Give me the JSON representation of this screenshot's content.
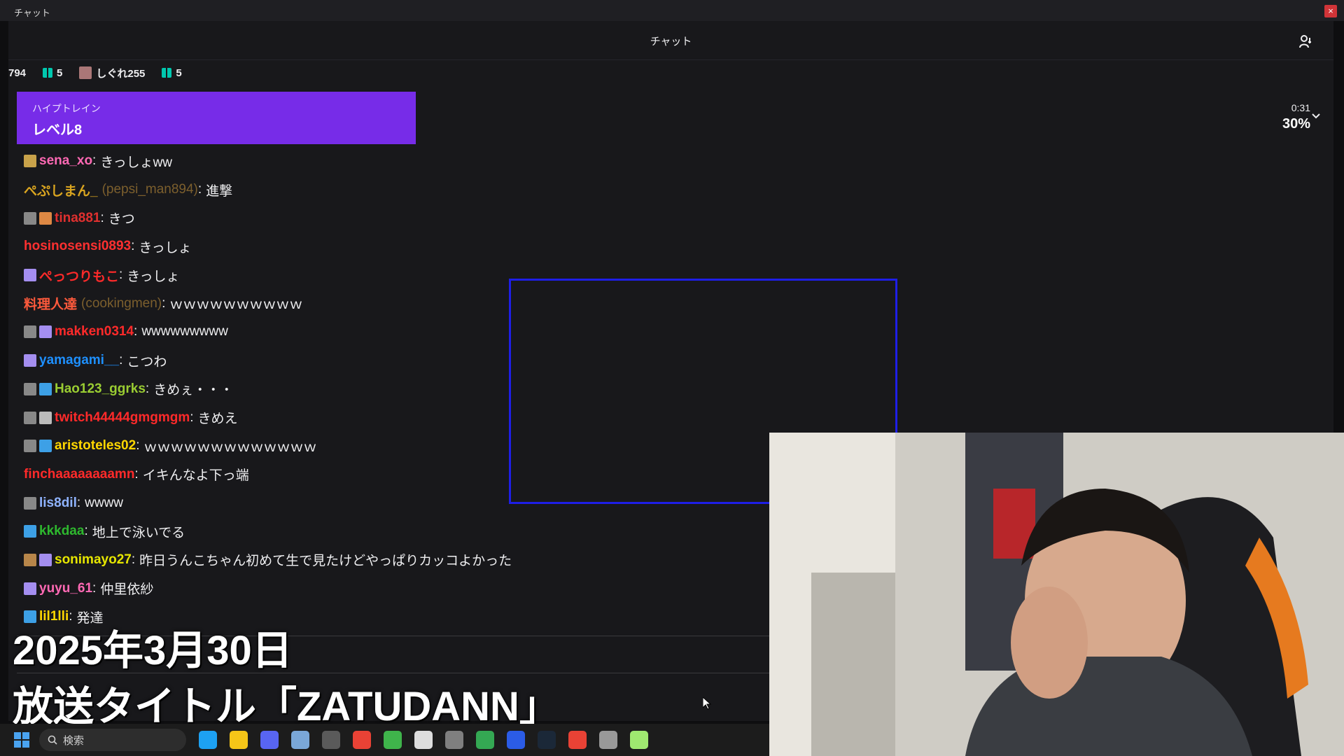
{
  "window": {
    "title": "チャット",
    "close_glyph": "×"
  },
  "chat": {
    "header_title": "チャット",
    "gifts": [
      {
        "label": "794",
        "icon": "none"
      },
      {
        "label": "5",
        "icon": "gift-icon"
      },
      {
        "label": "しぐれ255",
        "icon": "avatar-icon"
      },
      {
        "label": "5",
        "icon": "gift-icon"
      }
    ],
    "hype_train": {
      "label": "ハイプトレイン",
      "level": "レベル8",
      "time": "0:31",
      "percent": "30%"
    },
    "messages": [
      {
        "name": "sena_xo",
        "login": "",
        "text": "きっしょww",
        "color": "#ff69b4",
        "badges": [
          "#c8a24a"
        ]
      },
      {
        "name": "ぺぷしまん_",
        "login": "(pepsi_man894)",
        "text": "進撃",
        "color": "#daa520",
        "badges": []
      },
      {
        "name": "tina881",
        "login": "",
        "text": "きつ",
        "color": "#e0302f",
        "badges": [
          "#888",
          "#d84"
        ]
      },
      {
        "name": "hosinosensi0893",
        "login": "",
        "text": "きっしょ",
        "color": "#ff3030",
        "badges": []
      },
      {
        "name": "ぺっつりもこ",
        "login": "",
        "text": "きっしょ",
        "color": "#ff2a2a",
        "badges": [
          "#a48ef0"
        ]
      },
      {
        "name": "料理人達",
        "login": "(cookingmen)",
        "text": "ｗｗｗｗｗｗｗｗｗｗ",
        "color": "#ff5a3c",
        "badges": []
      },
      {
        "name": "makken0314",
        "login": "",
        "text": "wwwwwwwww",
        "color": "#ff2a2a",
        "badges": [
          "#888",
          "#a48ef0"
        ]
      },
      {
        "name": "yamagami__",
        "login": "",
        "text": "こつわ",
        "color": "#1e90ff",
        "badges": [
          "#a48ef0"
        ]
      },
      {
        "name": "Hao123_ggrks",
        "login": "",
        "text": "きめぇ・・・",
        "color": "#9acd32",
        "badges": [
          "#888",
          "#3da0e6"
        ]
      },
      {
        "name": "twitch44444gmgmgm",
        "login": "",
        "text": "きめえ",
        "color": "#ff2a2a",
        "badges": [
          "#888",
          "#bbb"
        ]
      },
      {
        "name": "aristoteles02",
        "login": "",
        "text": "ｗｗｗｗｗｗｗｗｗｗｗｗｗ",
        "color": "#ffd700",
        "badges": [
          "#888",
          "#3da0e6"
        ]
      },
      {
        "name": "finchaaaaaaaamn",
        "login": "",
        "text": "イキんなよ下っ端",
        "color": "#ff2a2a",
        "badges": []
      },
      {
        "name": "lis8dil",
        "login": "",
        "text": "wwww",
        "color": "#8fb3ff",
        "badges": [
          "#888"
        ]
      },
      {
        "name": "kkkdaa",
        "login": "",
        "text": "地上で泳いでる",
        "color": "#2eb82e",
        "badges": [
          "#3da0e6"
        ]
      },
      {
        "name": "sonimayo27",
        "login": "",
        "text": "昨日うんこちゃん初めて生で見たけどやっぱりカッコよかった",
        "color": "#e6e600",
        "badges": [
          "#b8864a",
          "#a48ef0"
        ]
      },
      {
        "name": "yuyu_61",
        "login": "",
        "text": "仲里依紗",
        "color": "#ff69b4",
        "badges": [
          "#a48ef0"
        ]
      },
      {
        "name": "lil1lli",
        "login": "",
        "text": "発達",
        "color": "#ffd700",
        "badges": [
          "#3da0e6"
        ]
      }
    ]
  },
  "overlay": {
    "date": "2025年3月30日",
    "title": "放送タイトル「ZATUDANN」"
  },
  "taskbar": {
    "search_placeholder": "検索",
    "apps": [
      "edge-icon",
      "explorer-icon",
      "discord-icon",
      "notepad-icon",
      "obs-icon",
      "chrome-icon",
      "minecraft-icon",
      "x-icon",
      "app-icon",
      "drive-icon",
      "display-icon",
      "steam-icon",
      "chrome-icon",
      "app-icon-2",
      "play-icon"
    ],
    "app_colors": [
      "#1da1f2",
      "#f5c518",
      "#5865f2",
      "#7aa7d8",
      "#5a5a5a",
      "#e94235",
      "#3fb44b",
      "#dddddd",
      "#7f7f7f",
      "#34a853",
      "#2b5ce6",
      "#1b2838",
      "#e94235",
      "#999999",
      "#9fe870"
    ]
  },
  "colors": {
    "hype_train": "#772ce8",
    "chat_bg": "#18181b",
    "selection_box": "#1e1ee6"
  }
}
